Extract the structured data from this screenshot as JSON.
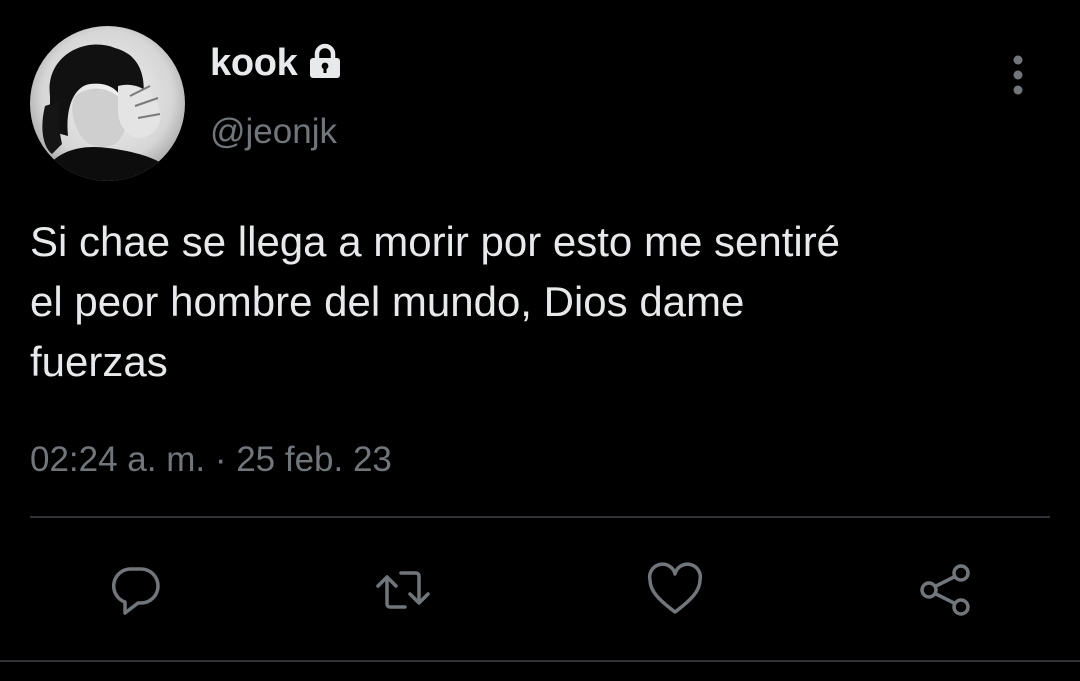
{
  "user": {
    "display_name": "kook",
    "handle": "@jeonjk",
    "protected_icon": "lock-icon",
    "avatar": "avatar"
  },
  "tweet": {
    "text": "Si chae se llega a morir por esto me sentiré\nel peor hombre del mundo, Dios dame\nfuerzas",
    "timestamp": "02:24 a. m. · 25 feb. 23"
  },
  "menu": {
    "icon": "more-vertical-icon"
  },
  "actions": [
    {
      "name": "reply",
      "icon": "reply-icon"
    },
    {
      "name": "retweet",
      "icon": "retweet-icon"
    },
    {
      "name": "like",
      "icon": "heart-icon"
    },
    {
      "name": "share",
      "icon": "share-icon"
    }
  ],
  "colors": {
    "background": "#000000",
    "primary_text": "#e7e9ea",
    "secondary_text": "#71767b",
    "divider": "#2f3336",
    "icon": "#71767b"
  }
}
